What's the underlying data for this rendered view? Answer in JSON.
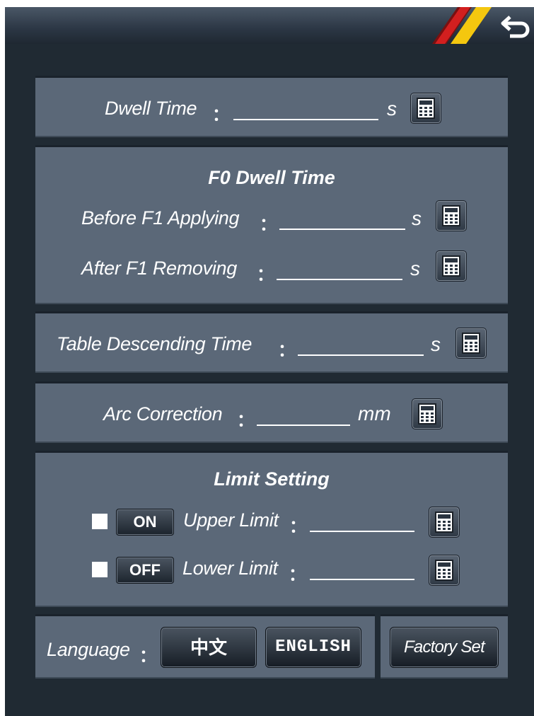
{
  "header": {
    "back_icon": "return-arrow-icon",
    "stripe_colors": [
      "#d21f1f",
      "#f4c70f"
    ]
  },
  "dwell": {
    "label": "Dwell Time",
    "colon": "：",
    "value": "",
    "unit": "s",
    "calc_icon": "calculator-icon"
  },
  "f0": {
    "title": "F0 Dwell Time",
    "before": {
      "label": "Before F1 Applying",
      "colon": "：",
      "value": "",
      "unit": "s"
    },
    "after": {
      "label": "After F1 Removing",
      "colon": "：",
      "value": "",
      "unit": "s"
    }
  },
  "table": {
    "label": "Table Descending Time",
    "colon": "：",
    "value": "",
    "unit": "s"
  },
  "arc": {
    "label": "Arc Correction",
    "colon": "：",
    "value": "",
    "unit": "mm"
  },
  "limit": {
    "title": "Limit Setting",
    "upper": {
      "toggle": "ON",
      "label": "Upper Limit",
      "colon": "：",
      "value": ""
    },
    "lower": {
      "toggle": "OFF",
      "label": "Lower Limit",
      "colon": "：",
      "value": ""
    }
  },
  "footer": {
    "language_label": "Language",
    "colon": "：",
    "chinese": "中文",
    "english": "ENGLISH",
    "factory": "Factory Set"
  }
}
